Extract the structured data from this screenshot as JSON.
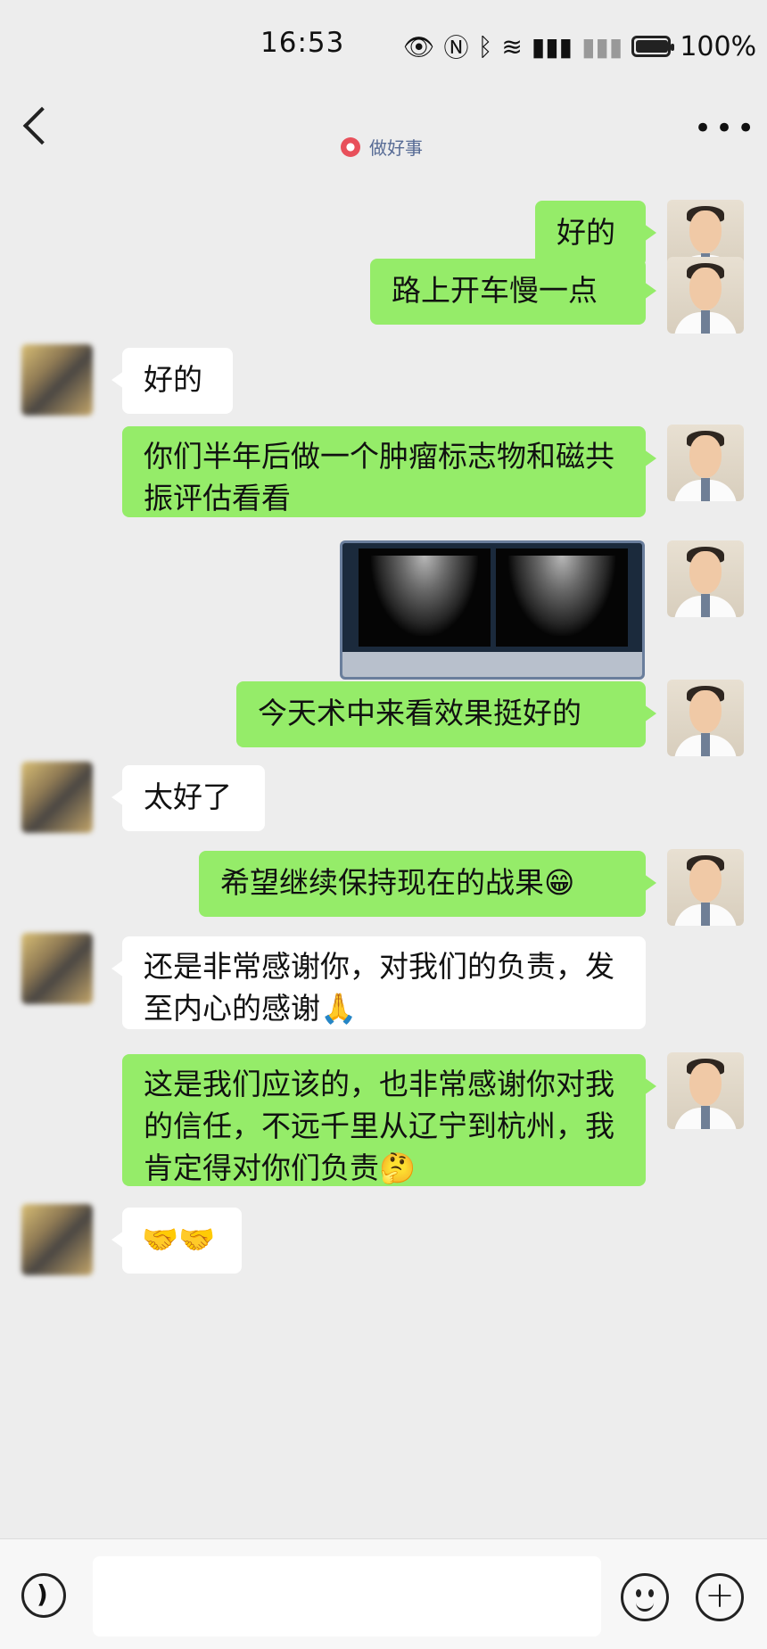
{
  "status_bar": {
    "time": "16:53",
    "icons": [
      "eye-icon",
      "nfc-icon",
      "bluetooth-icon",
      "wifi-icon",
      "4g-signal-icon",
      "no-signal-icon",
      "battery-icon"
    ],
    "battery_percent": "100%",
    "battery_level": 1.0
  },
  "header": {
    "title": "",
    "subtitle": "做好事",
    "back_icon": "back-icon",
    "more_icon": "more-icon"
  },
  "messages": [
    {
      "sender": "me",
      "text": "好的"
    },
    {
      "sender": "me",
      "text": "路上开车慢一点"
    },
    {
      "sender": "them",
      "text": "好的"
    },
    {
      "sender": "me",
      "text": "你们半年后做一个肿瘤标志物和磁共振评估看看"
    },
    {
      "sender": "me",
      "type": "image",
      "alt": "ultrasound-image"
    },
    {
      "sender": "me",
      "text": "今天术中来看效果挺好的"
    },
    {
      "sender": "them",
      "text": "太好了"
    },
    {
      "sender": "me",
      "text": "希望继续保持现在的战果😁"
    },
    {
      "sender": "them",
      "text": "还是非常感谢你，对我们的负责，发至内心的感谢🙏"
    },
    {
      "sender": "me",
      "text": "这是我们应该的，也非常感谢你对我的信任，不远千里从辽宁到杭州，我肯定得对你们负责🤔"
    },
    {
      "sender": "them",
      "text": "🤝🤝"
    }
  ],
  "input_bar": {
    "voice_icon": "voice-icon",
    "emoji_icon": "emoji-icon",
    "plus_icon": "plus-icon"
  },
  "colors": {
    "background": "#ededed",
    "my_bubble": "#95ec69",
    "their_bubble": "#ffffff",
    "subtitle": "#576b95"
  }
}
